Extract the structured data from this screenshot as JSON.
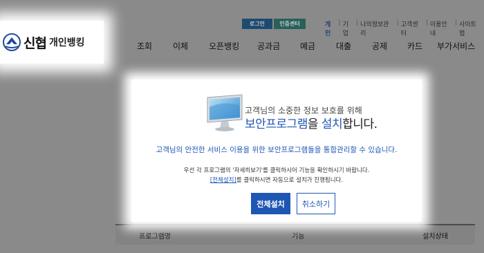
{
  "brand": {
    "name": "신협",
    "sub": "개인뱅킹"
  },
  "top_buttons": {
    "login": "로그인",
    "cert": "인증센터"
  },
  "util_links": [
    "개인",
    "기업",
    "나의정보관리",
    "고객센터",
    "이용안내",
    "사이트맵"
  ],
  "nav": [
    "조회",
    "이체",
    "오픈뱅킹",
    "공과금",
    "예금",
    "대출",
    "공제",
    "카드",
    "부가서비스"
  ],
  "modal": {
    "headline_1": "고객님의 소중한 정보 보호를 위해",
    "headline_2_blue": "보안프로그램",
    "headline_2_rest_a": "을 ",
    "headline_2_blue_b": "설치",
    "headline_2_rest_b": "합니다.",
    "notice": "고객님의 안전한 서비스 이용을 위한 보안프로그램들을 통합관리할 수 있습니다.",
    "instr_1": "우선 각 프로그램의 '자세히보기'를 클릭하시어 기능을 확인하시기 바랍니다.",
    "instr_2_link": "[전체설치]",
    "instr_2_rest": "를 클릭하시면 자동으로 설치가 진행됩니다.",
    "install_button": "전체설치",
    "cancel_button": "취소하기"
  },
  "table": {
    "headers": [
      "프로그램명",
      "기능",
      "설치상태"
    ]
  }
}
